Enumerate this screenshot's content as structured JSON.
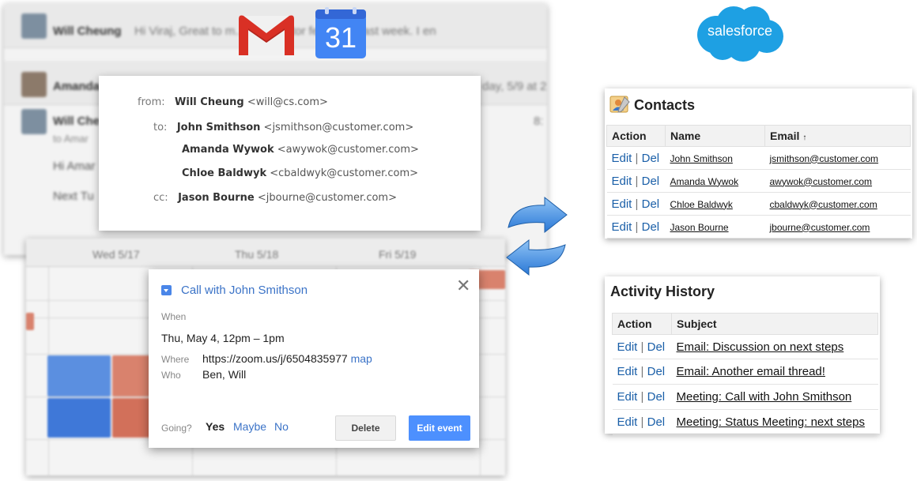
{
  "gmail": {
    "rows": [
      {
        "sender": "Will Cheung",
        "snippet": "Hi Viraj, Great to m... All investor feedback last week. I en"
      },
      {
        "sender": "Amanda",
        "snippet": "day, 5/9 at 2"
      },
      {
        "sender": "Will Che",
        "snippet": "8:"
      }
    ],
    "body_lines": [
      "to Amar",
      "Hi Amar",
      "Next Tu"
    ]
  },
  "calendar_logo": {
    "day": "31"
  },
  "salesforce_logo": {
    "text": "salesforce"
  },
  "email_header": {
    "from_label": "from:",
    "to_label": "to:",
    "cc_label": "cc:",
    "from": {
      "name": "Will Cheung",
      "email": "<will@cs.com>"
    },
    "to": [
      {
        "name": "John Smithson",
        "email": "<jsmithson@customer.com>"
      },
      {
        "name": "Amanda Wywok",
        "email": "<awywok@customer.com>"
      },
      {
        "name": "Chloe Baldwyk",
        "email": "<cbaldwyk@customer.com>"
      }
    ],
    "cc": {
      "name": "Jason Bourne",
      "email": "<jbourne@customer.com>"
    }
  },
  "calendar_bg": {
    "days": [
      "Wed 5/17",
      "Thu 5/18",
      "Fri 5/19"
    ],
    "colors": {
      "blue": "#5b8fe0",
      "red": "#d9826d"
    }
  },
  "event": {
    "title": "Call with John Smithson",
    "when_label": "When",
    "when": "Thu, May 4, 12pm – 1pm",
    "where_label": "Where",
    "where": "https://zoom.us/j/6504835977",
    "map_label": "map",
    "who_label": "Who",
    "who": "Ben, Will",
    "going_label": "Going?",
    "yes": "Yes",
    "maybe": "Maybe",
    "no": "No",
    "delete_label": "Delete",
    "edit_label": "Edit event"
  },
  "contacts": {
    "title": "Contacts",
    "headers": [
      "Action",
      "Name",
      "Email"
    ],
    "edit": "Edit",
    "del": "Del",
    "sep": "|",
    "rows": [
      {
        "name": "John Smithson",
        "email": "jsmithson@customer.com"
      },
      {
        "name": "Amanda Wywok",
        "email": "awywok@customer.com"
      },
      {
        "name": "Chloe Baldwyk",
        "email": "cbaldwyk@customer.com"
      },
      {
        "name": "Jason Bourne",
        "email": "jbourne@customer.com"
      }
    ]
  },
  "activity": {
    "title": "Activity History",
    "headers": [
      "Action",
      "Subject"
    ],
    "edit": "Edit",
    "del": "Del",
    "sep": "|",
    "rows": [
      {
        "subject": "Email: Discussion on next steps"
      },
      {
        "subject": "Email: Another email thread!"
      },
      {
        "subject": "Meeting: Call with John Smithson"
      },
      {
        "subject": "Meeting: Status Meeting: next steps"
      }
    ]
  },
  "accent_colors": {
    "link": "#1a5fa8",
    "google_blue": "#4d90fe",
    "salesforce_blue": "#1ea0e3"
  }
}
